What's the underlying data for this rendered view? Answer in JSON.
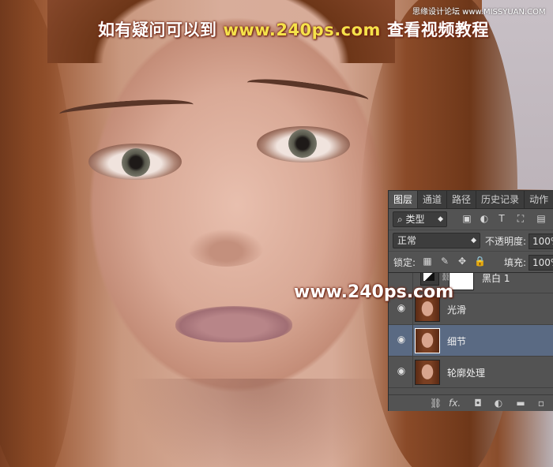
{
  "overlay": {
    "banner_left": "如有疑问可以到",
    "banner_url": "www.240ps.com",
    "banner_right": "查看视频教程",
    "watermark_top_right": "思缘设计论坛 www.MISSYUAN.COM",
    "watermark_center": "www.240ps.com"
  },
  "layers_panel": {
    "tabs": [
      {
        "label": "图层",
        "active": true
      },
      {
        "label": "通道"
      },
      {
        "label": "路径"
      },
      {
        "label": "历史记录"
      },
      {
        "label": "动作"
      }
    ],
    "filter": {
      "search_icon": "search-icon",
      "kind": "类型"
    },
    "blend": {
      "mode": "正常",
      "opacity_label": "不透明度:",
      "opacity_value": "100%"
    },
    "lock": {
      "label": "锁定:",
      "fill_label": "填充:",
      "fill_value": "100%"
    },
    "layers": [
      {
        "name": "黑白 1",
        "type": "adjustment",
        "visible": false
      },
      {
        "name": "光滑",
        "type": "pixel",
        "visible": true
      },
      {
        "name": "细节",
        "type": "pixel",
        "visible": true,
        "selected": true
      },
      {
        "name": "轮廓处理",
        "type": "pixel",
        "visible": true
      }
    ],
    "bottom_icons": [
      "link-icon",
      "fx-icon",
      "mask-icon",
      "adjustment-icon",
      "folder-icon",
      "new-layer-icon"
    ],
    "fx_label": "fx."
  }
}
